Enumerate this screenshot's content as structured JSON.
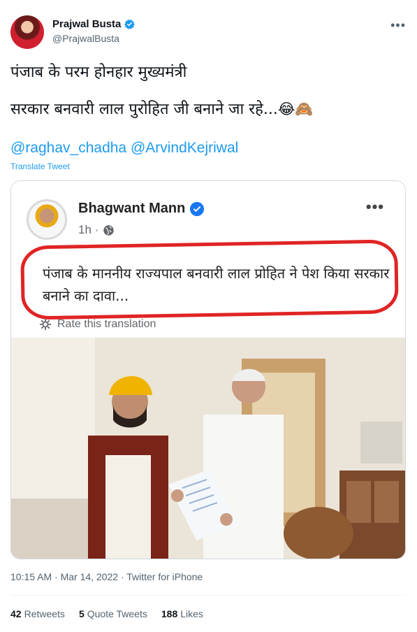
{
  "tweet": {
    "display_name": "Prajwal Busta",
    "handle": "@PrajwalBusta",
    "more_icon": "ellipsis-icon",
    "line1": "पंजाब के परम होनहार मुख्यमंत्री",
    "line2": "सरकार बनवारी लाल पुरोहित जी बनाने जा रहे...",
    "emojis": "😂🙈",
    "mention1": "@raghav_chadha",
    "mention2": "@ArvindKejriwal",
    "translate_label": "Translate Tweet",
    "timestamp": "10:15 AM · Mar 14, 2022 · Twitter for iPhone",
    "accent_color": "#1d9bf0"
  },
  "embedded_post": {
    "author": "Bhagwant Mann",
    "meta": "1h ·",
    "text": "पंजाब के माननीय राज्यपाल बनवारी लाल प्रोहित ने पेश किया सरकार बनाने का दावा...",
    "rate_label": "Rate this translation",
    "highlight_color": "#e02424"
  },
  "stats": {
    "retweets_count": "42",
    "retweets_label": "Retweets",
    "quotes_count": "5",
    "quotes_label": "Quote Tweets",
    "likes_count": "188",
    "likes_label": "Likes"
  }
}
